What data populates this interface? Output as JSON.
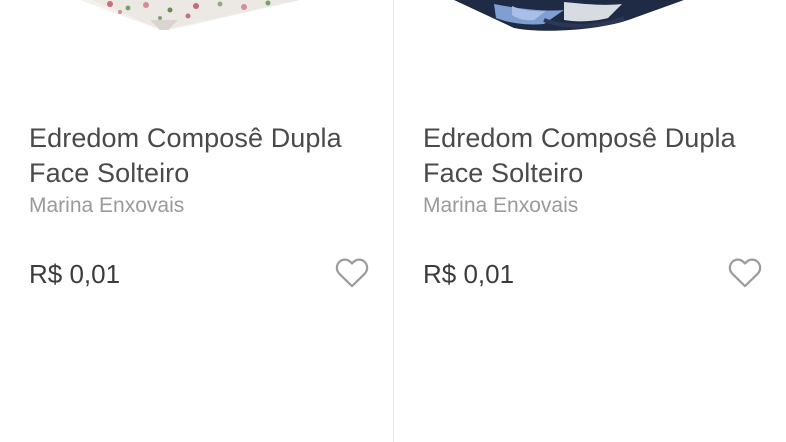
{
  "products": [
    {
      "title_line1": "Edredom Composê Dupla",
      "title_line2": "Face Solteiro",
      "brand": "Marina Enxovais",
      "price": "R$ 0,01",
      "image_icon": "floral-comforter-image",
      "favorite_icon": "heart-outline-icon"
    },
    {
      "title_line1": "Edredom Composê Dupla",
      "title_line2": "Face Solteiro",
      "brand": "Marina Enxovais",
      "price": "R$ 0,01",
      "image_icon": "blue-comforter-image",
      "favorite_icon": "heart-outline-icon"
    }
  ],
  "colors": {
    "title": "#4a4a4a",
    "brand": "#9a9a9a",
    "price": "#3c3c3c",
    "heart": "#9b9b9b",
    "divider": "#e6e6e6"
  }
}
